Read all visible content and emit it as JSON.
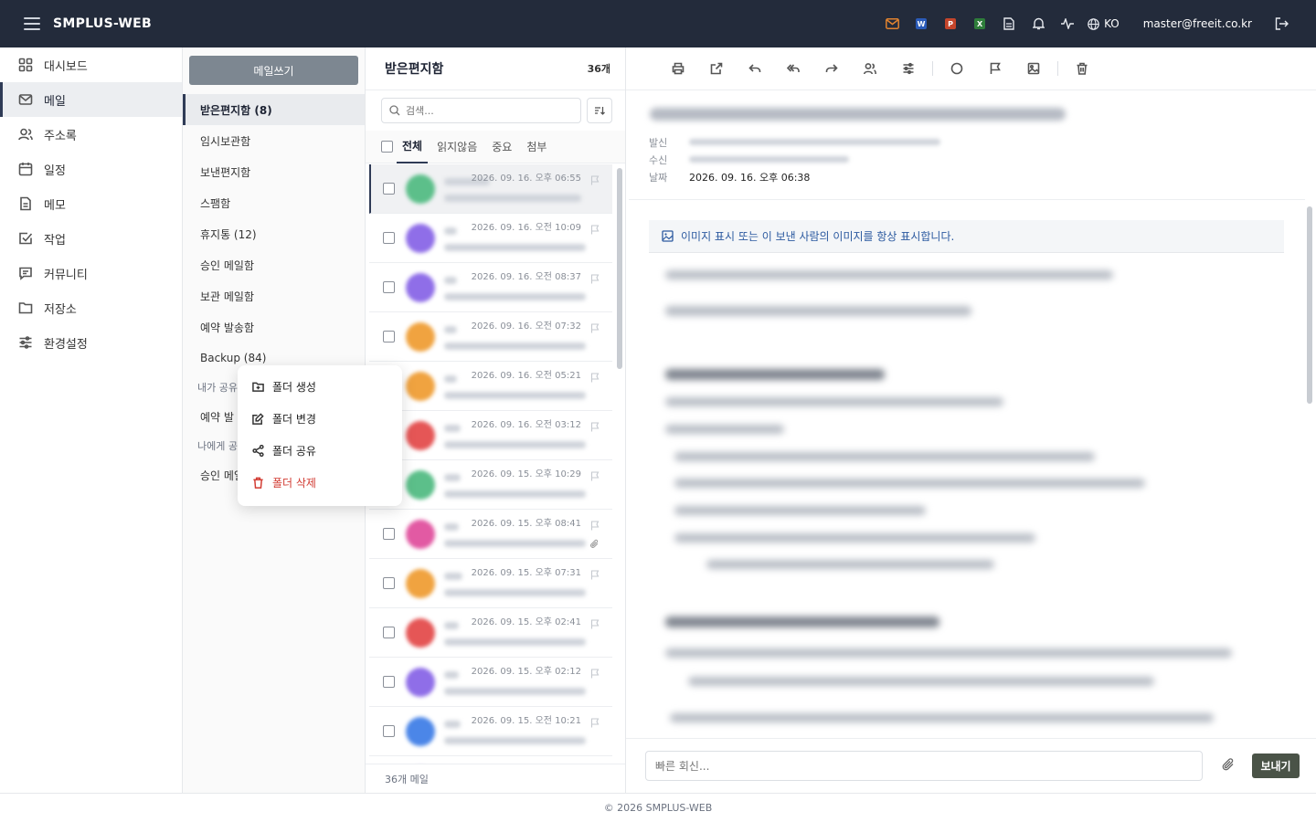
{
  "header": {
    "brand": "SMPLUS-WEB",
    "app_badges": [
      {
        "letter": "W",
        "color": "#2b5bb8"
      },
      {
        "letter": "P",
        "color": "#c4452b"
      },
      {
        "letter": "X",
        "color": "#2e7d3a"
      }
    ],
    "mail_icon_color": "#e0822f",
    "lang": "KO",
    "user_email": "master@freeit.co.kr"
  },
  "nav": {
    "items": [
      {
        "label": "대시보드",
        "icon": "dashboard-icon"
      },
      {
        "label": "메일",
        "icon": "mail-icon"
      },
      {
        "label": "주소록",
        "icon": "contacts-icon"
      },
      {
        "label": "일정",
        "icon": "calendar-icon"
      },
      {
        "label": "메모",
        "icon": "memo-icon"
      },
      {
        "label": "작업",
        "icon": "task-icon"
      },
      {
        "label": "커뮤니티",
        "icon": "community-icon"
      },
      {
        "label": "저장소",
        "icon": "folder-icon"
      },
      {
        "label": "환경설정",
        "icon": "settings-icon"
      }
    ]
  },
  "folders": {
    "compose_label": "메일쓰기",
    "items": [
      "받은편지함 (8)",
      "임시보관함",
      "보낸편지함",
      "스팸함",
      "휴지통 (12)",
      "승인 메일함",
      "보관 메일함",
      "예약 발송함",
      "Backup (84)"
    ],
    "shared_by_me_label": "내가 공유",
    "shared_by_me_item": "예약 발",
    "shared_to_me_label": "나에게 공",
    "shared_to_me_item": "승인 메일"
  },
  "context_menu": {
    "items": [
      "폴더 생성",
      "폴더 변경",
      "폴더 공유",
      "폴더 삭제"
    ]
  },
  "mail_list": {
    "title": "받은편지함",
    "count": "36개",
    "search_placeholder": "검색...",
    "tabs": [
      "전체",
      "읽지않음",
      "중요",
      "첨부"
    ],
    "footer": "36개 메일",
    "rows": [
      {
        "date": "2026. 09. 16. 오후 06:55",
        "color": "#5cbf8a"
      },
      {
        "date": "2026. 09. 16. 오전 10:09",
        "color": "#8f6ee8"
      },
      {
        "date": "2026. 09. 16. 오전 08:37",
        "color": "#8f6ee8"
      },
      {
        "date": "2026. 09. 16. 오전 07:32",
        "color": "#f0a340"
      },
      {
        "date": "2026. 09. 16. 오전 05:21",
        "color": "#f0a340"
      },
      {
        "date": "2026. 09. 16. 오전 03:12",
        "color": "#e55656"
      },
      {
        "date": "2026. 09. 15. 오후 10:29",
        "color": "#5cbf8a"
      },
      {
        "date": "2026. 09. 15. 오후 08:41",
        "color": "#e25aa3"
      },
      {
        "date": "2026. 09. 15. 오후 07:31",
        "color": "#f0a340"
      },
      {
        "date": "2026. 09. 15. 오후 02:41",
        "color": "#e55656"
      },
      {
        "date": "2026. 09. 15. 오후 02:12",
        "color": "#8f6ee8"
      },
      {
        "date": "2026. 09. 15. 오전 10:21",
        "color": "#4b86e8"
      },
      {
        "date": "",
        "color": "#8f6ee8"
      }
    ]
  },
  "reader": {
    "labels": {
      "from": "발신",
      "to": "수신",
      "date": "날짜"
    },
    "date_value": "2026. 09. 16. 오후 06:38",
    "image_notice": "이미지 표시 또는 이 보낸 사람의 이미지를 항상 표시합니다.",
    "quick_reply_placeholder": "빠른 회신...",
    "send_label": "보내기"
  },
  "footer": {
    "text": "© 2026 SMPLUS-WEB"
  }
}
